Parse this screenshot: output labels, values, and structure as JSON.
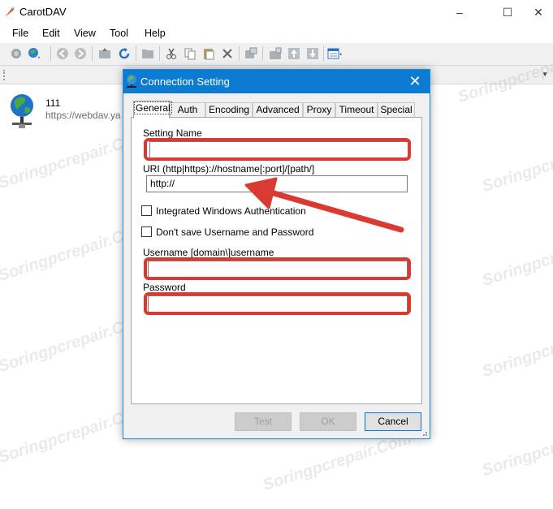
{
  "app": {
    "title": "CarotDAV",
    "controls": {
      "minimize": "–",
      "maximize": "☐",
      "close": "✕"
    }
  },
  "menu": [
    "File",
    "Edit",
    "View",
    "Tool",
    "Help"
  ],
  "filelist": {
    "entries": [
      {
        "name": "111",
        "url": "https://webdav.ya",
        "icon": "globe-network-icon"
      }
    ]
  },
  "dialog": {
    "title": "Connection Setting",
    "close_glyph": "✕",
    "tabs": [
      "General",
      "Auth",
      "Encoding",
      "Advanced",
      "Proxy",
      "Timeout",
      "Special"
    ],
    "active_tab": "General",
    "setting_name_label": "Setting Name",
    "setting_name_value": "",
    "uri_label": "URI  (http|https)://hostname[:port]/[path/]",
    "uri_value": "http://",
    "integrated_auth_label": "Integrated Windows Authentication",
    "integrated_auth_checked": false,
    "dont_save_label": "Don't save Username and Password",
    "dont_save_checked": false,
    "username_label": "Username  [domain\\]username",
    "username_value": "",
    "password_label": "Password",
    "password_value": "",
    "buttons": {
      "test": "Test",
      "ok": "OK",
      "cancel": "Cancel"
    }
  },
  "annotation": {
    "highlight_color": "#d93a32",
    "arrow_color": "#d93a32"
  },
  "watermark": "Soringpcrepair.Com",
  "colors": {
    "dialog_titlebar": "#0c7bd2",
    "accent": "#0078d7"
  }
}
